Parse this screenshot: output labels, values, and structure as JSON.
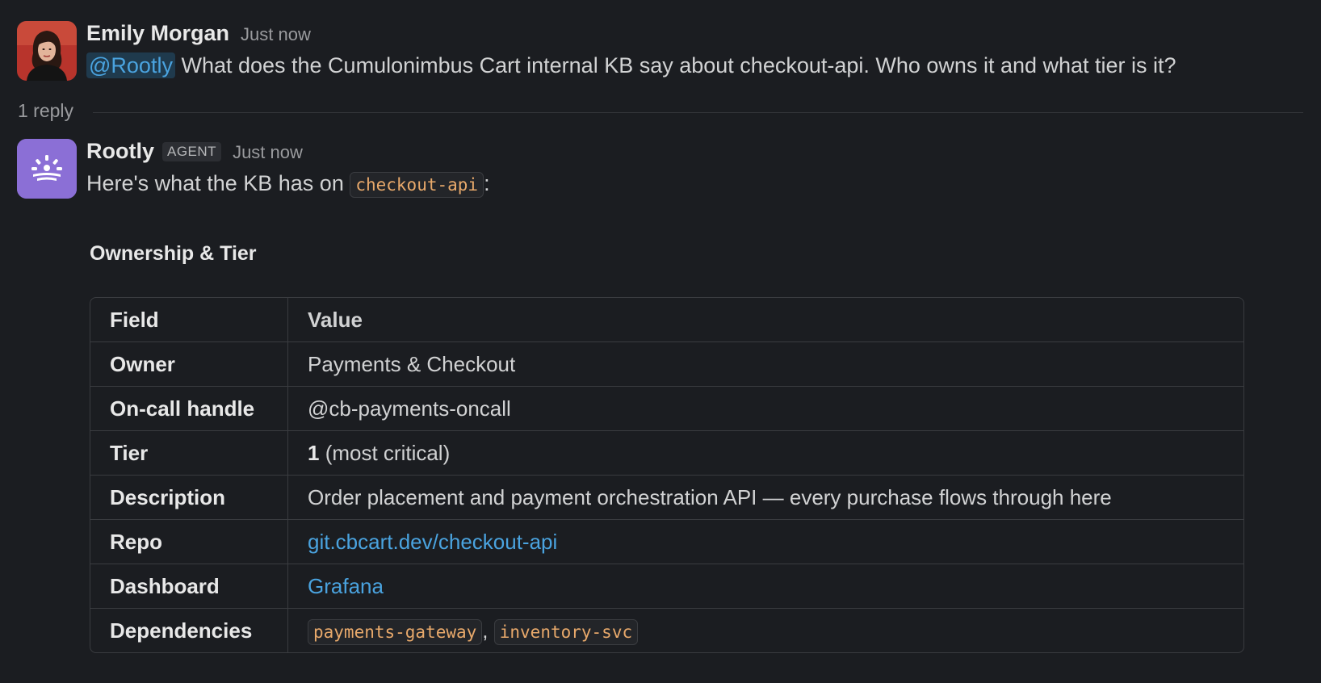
{
  "message1": {
    "author": "Emily Morgan",
    "time": "Just now",
    "mention": "@Rootly",
    "text": " What does the Cumulonimbus Cart internal KB say about checkout-api. Who owns it and what tier is it?"
  },
  "thread": {
    "reply_count": "1 reply"
  },
  "message2": {
    "author": "Rootly",
    "badge": "AGENT",
    "time": "Just now",
    "intro_text": "Here's what the KB has on ",
    "intro_code": "checkout-api",
    "intro_suffix": ":",
    "section_title": "Ownership & Tier",
    "table": {
      "header": {
        "field": "Field",
        "value": "Value"
      },
      "rows": {
        "owner": {
          "field": "Owner",
          "value": "Payments & Checkout"
        },
        "oncall": {
          "field": "On-call handle",
          "value": "@cb-payments-oncall"
        },
        "tier": {
          "field": "Tier",
          "value_bold": "1",
          "value_rest": " (most critical)"
        },
        "description": {
          "field": "Description",
          "value": "Order placement and payment orchestration API — every purchase flows through here"
        },
        "repo": {
          "field": "Repo",
          "value": "git.cbcart.dev/checkout-api"
        },
        "dashboard": {
          "field": "Dashboard",
          "value": "Grafana"
        },
        "dependencies": {
          "field": "Dependencies",
          "dep1": "payments-gateway",
          "separator": ", ",
          "dep2": "inventory-svc"
        }
      }
    }
  },
  "colors": {
    "background": "#1b1d21",
    "link": "#4aa3df",
    "code_text": "#e8a96b",
    "agent_avatar": "#8b6fd6"
  },
  "icons": {
    "user_avatar": "user-photo-avatar",
    "agent_avatar": "rootly-logo-icon"
  }
}
